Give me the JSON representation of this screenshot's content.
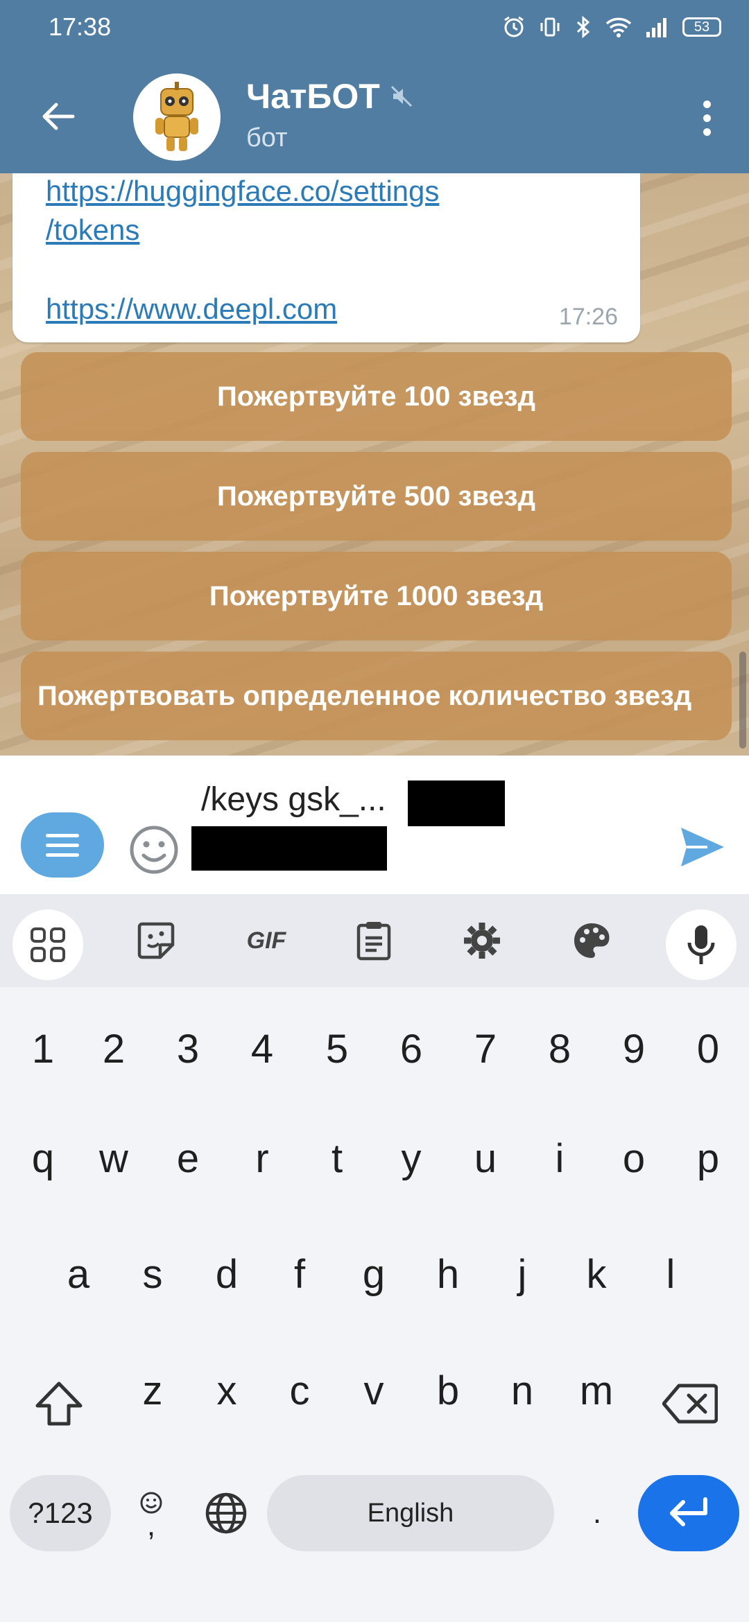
{
  "status_bar": {
    "time": "17:38",
    "battery": "53"
  },
  "header": {
    "title": "ЧатБОТ",
    "subtitle": "бот"
  },
  "message": {
    "link1_part1": "https://huggingface.co/settings",
    "link1_part2": "/tokens",
    "link2": "https://www.deepl.com",
    "time": "17:26"
  },
  "bot_buttons": [
    {
      "label": "Пожертвуйте 100 звезд"
    },
    {
      "label": "Пожертвуйте 500 звезд"
    },
    {
      "label": "Пожертвуйте 1000 звезд"
    },
    {
      "label": "Пожертвовать определенное количество звезд"
    }
  ],
  "input": {
    "text": "/keys gsk_..."
  },
  "keyboard": {
    "number_row": [
      "1",
      "2",
      "3",
      "4",
      "5",
      "6",
      "7",
      "8",
      "9",
      "0"
    ],
    "row1": [
      "q",
      "w",
      "e",
      "r",
      "t",
      "y",
      "u",
      "i",
      "o",
      "p"
    ],
    "row2": [
      "a",
      "s",
      "d",
      "f",
      "g",
      "h",
      "j",
      "k",
      "l"
    ],
    "row3": [
      "z",
      "x",
      "c",
      "v",
      "b",
      "n",
      "m"
    ],
    "symbols_label": "?123",
    "comma": ",",
    "space_label": "English",
    "period": ".",
    "toolbar_gif": "GIF"
  },
  "colors": {
    "header": "#517da2",
    "accent": "#5fa8e0",
    "button": "#c49156",
    "enter_key": "#1a73e8"
  }
}
